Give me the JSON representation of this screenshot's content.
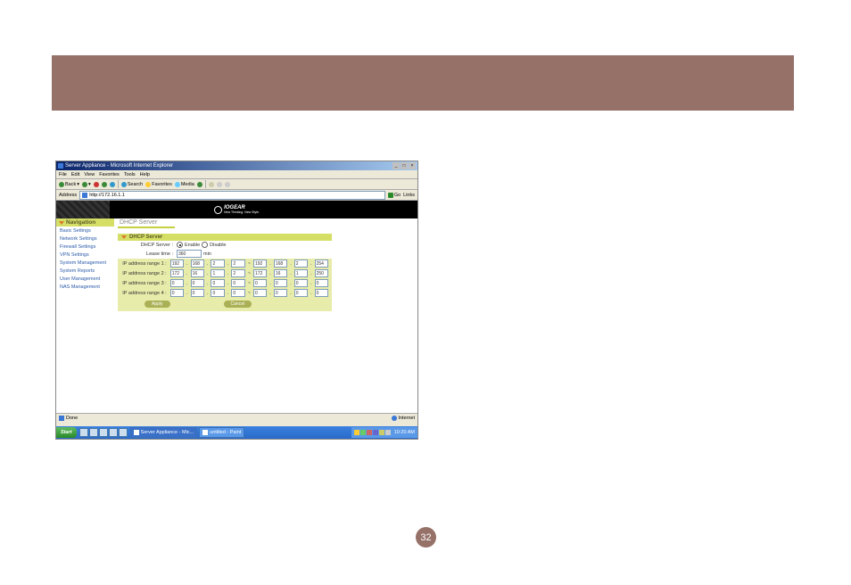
{
  "banner": {},
  "browser": {
    "title": "Server Appliance - Microsoft Internet Explorer",
    "menu": {
      "file": "File",
      "edit": "Edit",
      "view": "View",
      "favorites": "Favorites",
      "tools": "Tools",
      "help": "Help"
    },
    "toolbar": {
      "back": "Back",
      "search": "Search",
      "favorites": "Favorites",
      "media": "Media"
    },
    "address_label": "Address",
    "address_value": "http://172.16.1.1",
    "go": "Go",
    "links": "Links",
    "status_done": "Done",
    "status_zone": "Internet"
  },
  "logo": {
    "brand": "IOGEAR",
    "tag": "New Thinking. New Style."
  },
  "nav": {
    "header": "Navigation",
    "items": [
      "Basic Settings",
      "Network Settings",
      "Firewall Settings",
      "VPN Settings",
      "System Management",
      "System Reports",
      "User Management",
      "NAS Management"
    ]
  },
  "page": {
    "title": "DHCP Server",
    "form_header": "DHCP Server",
    "rows": {
      "dhcp_server_label": "DHCP Server :",
      "enable": "Enable",
      "disable": "Disable",
      "lease_time_label": "Lease time :",
      "lease_time_value": "360",
      "lease_time_unit": "min",
      "range_labels": [
        "IP address range 1 :",
        "IP address range 2 :",
        "IP address range 3 :",
        "IP address range 4 :"
      ],
      "ranges": [
        {
          "from": [
            "192",
            "168",
            "2",
            "2"
          ],
          "to": [
            "192",
            "168",
            "2",
            "254"
          ]
        },
        {
          "from": [
            "172",
            "16",
            "1",
            "2"
          ],
          "to": [
            "172",
            "16",
            "1",
            "250"
          ]
        },
        {
          "from": [
            "0",
            "0",
            "0",
            "0"
          ],
          "to": [
            "0",
            "0",
            "0",
            "0"
          ]
        },
        {
          "from": [
            "0",
            "0",
            "0",
            "0"
          ],
          "to": [
            "0",
            "0",
            "0",
            "0"
          ]
        }
      ]
    },
    "apply": "Apply",
    "cancel": "Cancel"
  },
  "taskbar": {
    "start": "Start",
    "tasks": [
      {
        "label": "Server Appliance - Mic..."
      },
      {
        "label": "untitled - Paint"
      }
    ],
    "clock": "10:20 AM"
  },
  "page_number": "32"
}
